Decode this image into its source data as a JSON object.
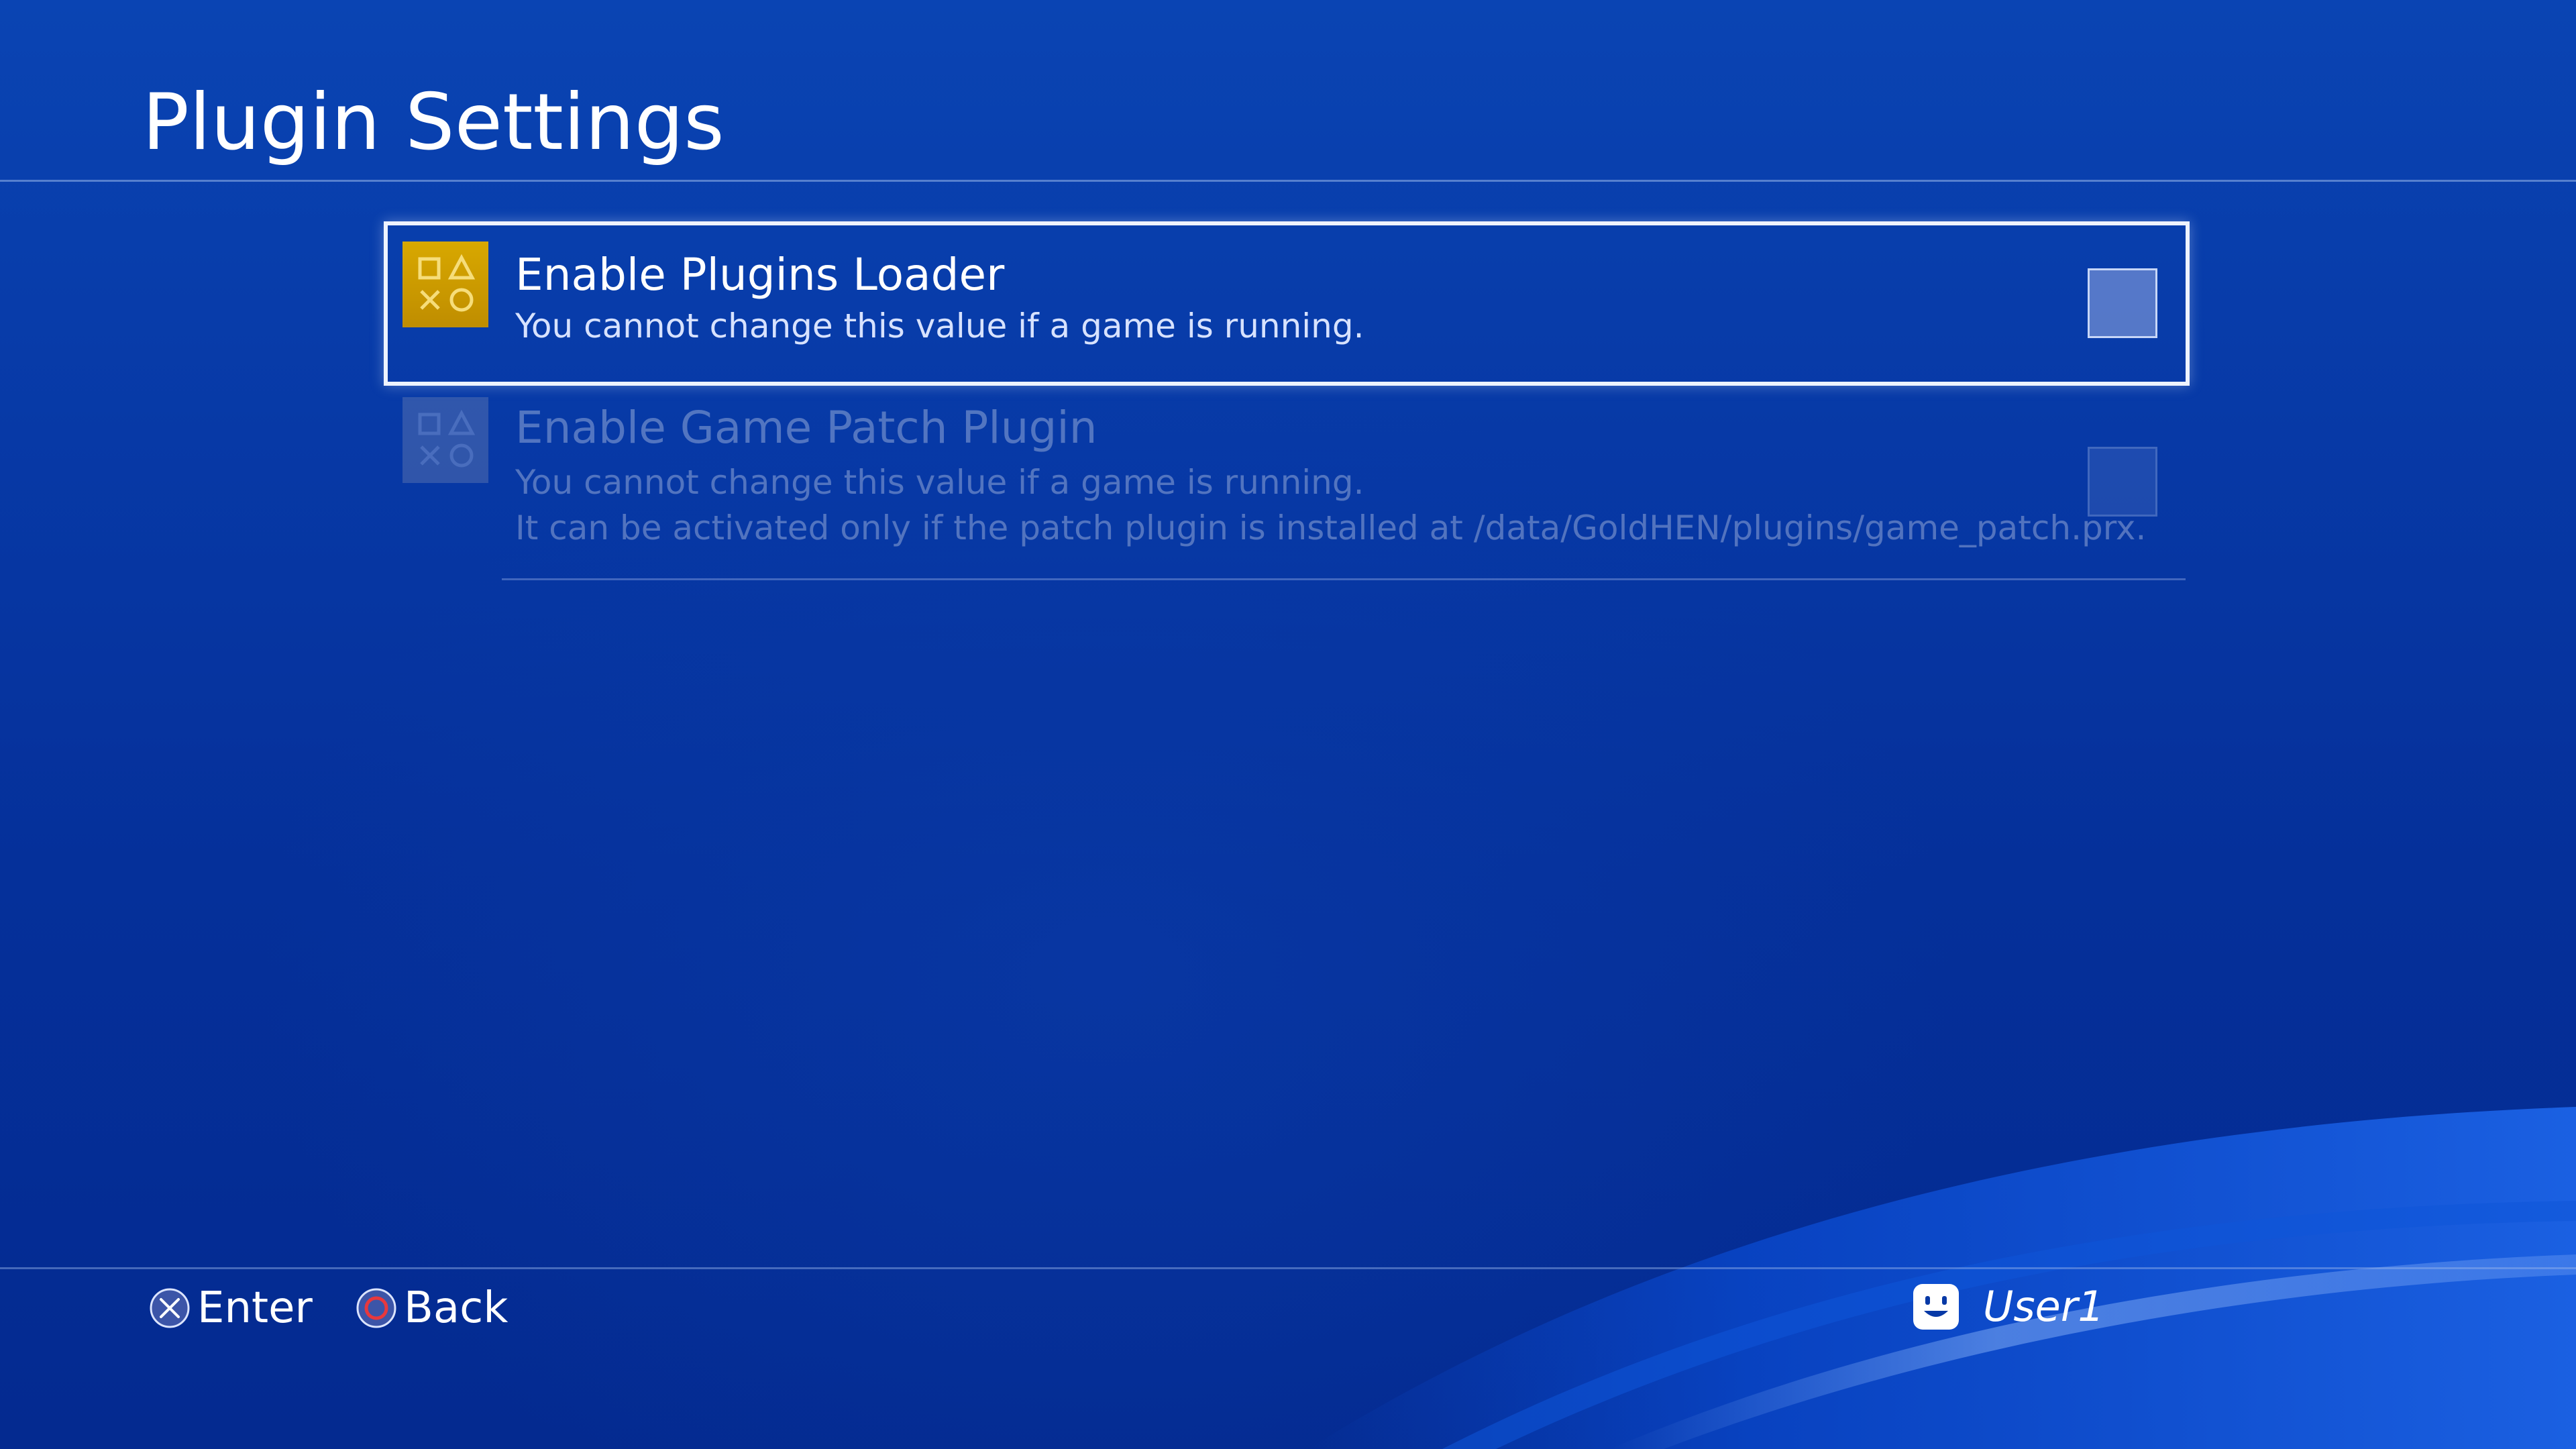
{
  "header": {
    "title": "Plugin Settings"
  },
  "settings": [
    {
      "title": "Enable Plugins Loader",
      "description_lines": [
        "You cannot change this value if a game is running."
      ],
      "checked": false,
      "focused": true,
      "enabled": true,
      "icon": "ps-shapes-icon"
    },
    {
      "title": "Enable Game Patch Plugin",
      "description_lines": [
        "You cannot change this value if a game is running.",
        "It can be activated only if the patch plugin is installed at /data/GoldHEN/plugins/game_patch.prx."
      ],
      "checked": false,
      "focused": false,
      "enabled": false,
      "icon": "ps-shapes-icon"
    }
  ],
  "footer": {
    "enter_label": "Enter",
    "back_label": "Back",
    "enter_icon": "cross-button-icon",
    "back_icon": "circle-button-icon",
    "user_name": "User1",
    "user_icon": "avatar-face-icon"
  },
  "colors": {
    "background": "#0739a6",
    "icon_active": "#d0a000",
    "circle_button": "#e8383d",
    "focus_border": "#eef3ff"
  }
}
